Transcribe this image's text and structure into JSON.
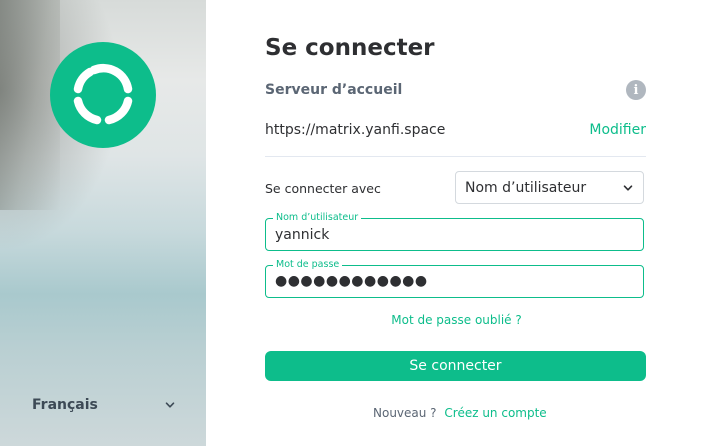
{
  "brand": {
    "accent": "#0dbd8b",
    "logo_icon": "element-logo-icon"
  },
  "language": {
    "selected": "Français",
    "icon": "chevron-down-icon"
  },
  "login": {
    "title": "Se connecter",
    "server_heading": "Serveur d’accueil",
    "info_icon_glyph": "i",
    "server_url": "https://matrix.yanfi.space",
    "modify_label": "Modifier",
    "login_with_label": "Se connecter avec",
    "login_with_selected": "Nom d’utilisateur",
    "username_label": "Nom d’utilisateur",
    "username_value": "yannick",
    "password_label": "Mot de passe",
    "password_value": "●●●●●●●●●●●●",
    "forgot_password": "Mot de passe oublié ?",
    "submit_label": "Se connecter",
    "new_label": "Nouveau ?",
    "create_account": "Créez un compte"
  }
}
